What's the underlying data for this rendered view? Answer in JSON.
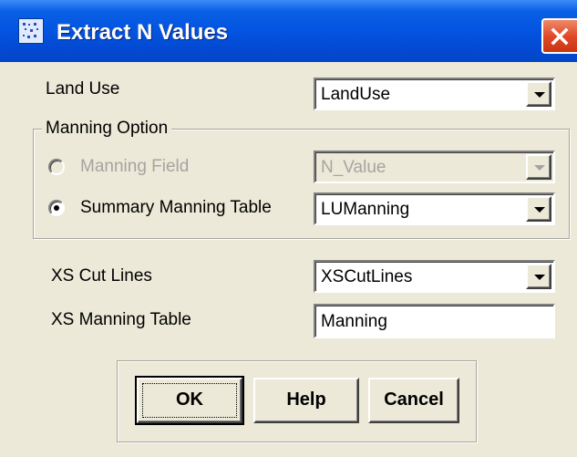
{
  "window": {
    "title": "Extract N Values"
  },
  "land_use": {
    "label": "Land Use",
    "value": "LandUse"
  },
  "manning_option": {
    "legend": "Manning Option",
    "manning_field": {
      "label": "Manning Field",
      "value": "N_Value",
      "selected": false,
      "enabled": false
    },
    "summary_table": {
      "label": "Summary Manning Table",
      "value": "LUManning",
      "selected": true,
      "enabled": true
    }
  },
  "xs_cut_lines": {
    "label": "XS Cut Lines",
    "value": "XSCutLines"
  },
  "xs_manning_table": {
    "label": "XS Manning Table",
    "value": "Manning"
  },
  "buttons": {
    "ok": "OK",
    "help": "Help",
    "cancel": "Cancel"
  },
  "icons": {
    "app": "grid-map-icon",
    "close": "close-icon",
    "dropdown": "chevron-down-icon"
  }
}
